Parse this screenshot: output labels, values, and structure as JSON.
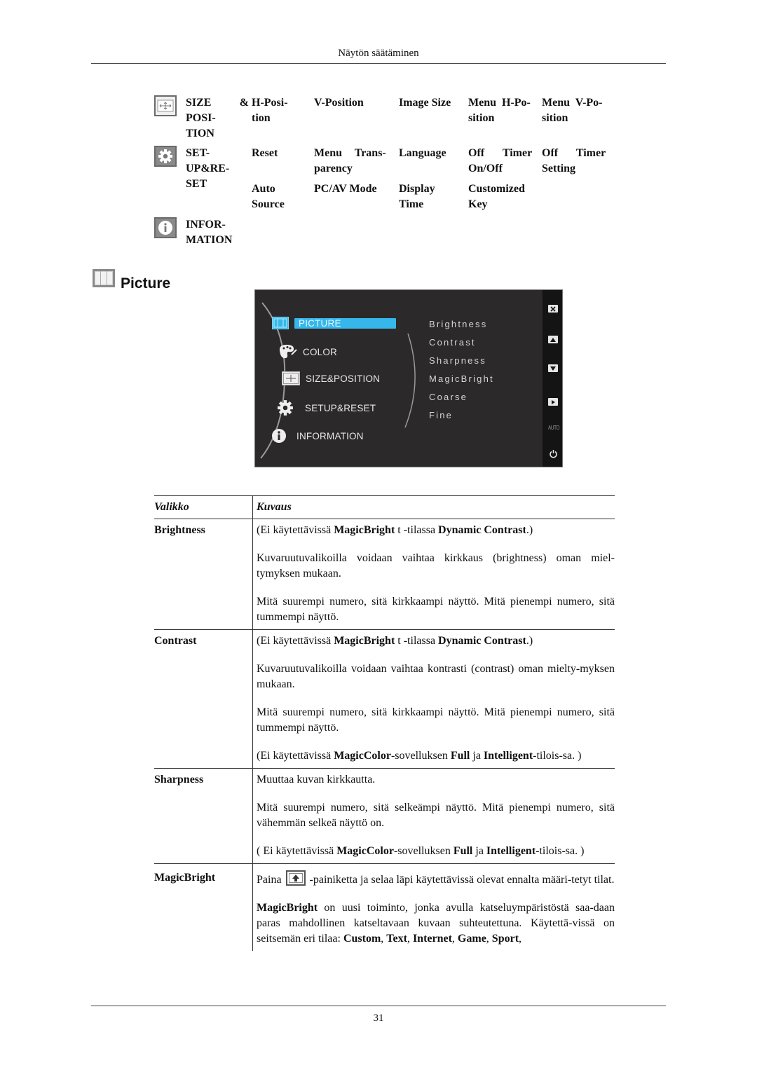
{
  "header": {
    "running_title": "Näytön säätäminen"
  },
  "overview": {
    "rows": [
      {
        "icon": "size-position-icon",
        "name": "SIZE & POSI- TION",
        "name_lines": [
          "SIZE",
          "POSI-",
          "TION"
        ],
        "name_amp": "&",
        "items": [
          {
            "lines": [
              "H-Posi-",
              "tion"
            ]
          },
          {
            "lines": [
              "V-Position"
            ]
          },
          {
            "lines": [
              "Image Size"
            ]
          },
          {
            "lines": [
              "Menu H-Po-",
              "sition"
            ]
          },
          {
            "lines": [
              "Menu V-Po-",
              "sition"
            ]
          }
        ]
      },
      {
        "icon": "gear-icon",
        "name_lines": [
          "SET-",
          "UP&RE-",
          "SET"
        ],
        "items": [
          {
            "lines": [
              "Reset"
            ]
          },
          {
            "lines": [
              "Menu Trans-",
              "parency"
            ]
          },
          {
            "lines": [
              "Language"
            ]
          },
          {
            "lines": [
              "Off Timer",
              "On/Off"
            ]
          },
          {
            "lines": [
              "Off Timer",
              "Setting"
            ]
          },
          {
            "lines": [
              "Auto",
              "Source"
            ]
          },
          {
            "lines": [
              "PC/AV Mode"
            ]
          },
          {
            "lines": [
              "Display",
              "Time"
            ]
          },
          {
            "lines": [
              "Customized",
              "Key"
            ]
          }
        ]
      },
      {
        "icon": "info-icon",
        "name_lines": [
          "INFOR-",
          "MATION"
        ],
        "items": []
      }
    ]
  },
  "section": {
    "title": "Picture",
    "icon": "picture-icon"
  },
  "osd": {
    "menu": [
      {
        "label": "PICTURE",
        "icon": "picture-icon",
        "active": true
      },
      {
        "label": "COLOR",
        "icon": "palette-icon",
        "active": false
      },
      {
        "label": "SIZE&POSITION",
        "icon": "size-position-icon",
        "active": false
      },
      {
        "label": "SETUP&RESET",
        "icon": "gear-icon",
        "active": false
      },
      {
        "label": "INFORMATION",
        "icon": "info-icon",
        "active": false
      }
    ],
    "submenu": [
      "Brightness",
      "Contrast",
      "Sharpness",
      "MagicBright",
      "Coarse",
      "Fine"
    ],
    "side_buttons": [
      "close-icon",
      "up-arrow-icon",
      "down-arrow-icon",
      "enter-icon",
      "auto",
      "power-icon"
    ],
    "side_auto_label": "AUTO",
    "accent_color": "#35b7ec"
  },
  "table": {
    "headers": {
      "menu": "Valikko",
      "description": "Kuvaus"
    },
    "rows": [
      {
        "menu": "Brightness",
        "paragraphs": [
          [
            [
              "(Ei käytettävissä ",
              false
            ],
            [
              "MagicBright",
              true
            ],
            [
              " t -tilassa ",
              false
            ],
            [
              "Dynamic Contrast",
              true
            ],
            [
              ".)",
              false
            ]
          ],
          [
            [
              "Kuvaruutuvalikoilla voidaan vaihtaa kirkkaus (brightness) oman miel-tymyksen mukaan.",
              false
            ]
          ],
          [
            [
              "Mitä suurempi numero, sitä kirkkaampi näyttö. Mitä pienempi numero, sitä tummempi näyttö.",
              false
            ]
          ]
        ]
      },
      {
        "menu": "Contrast",
        "paragraphs": [
          [
            [
              "(Ei käytettävissä ",
              false
            ],
            [
              "MagicBright",
              true
            ],
            [
              " t -tilassa ",
              false
            ],
            [
              "Dynamic Contrast",
              true
            ],
            [
              ".)",
              false
            ]
          ],
          [
            [
              "Kuvaruutuvalikoilla voidaan vaihtaa kontrasti (contrast) oman mielty-myksen mukaan.",
              false
            ]
          ],
          [
            [
              "Mitä suurempi numero, sitä kirkkaampi näyttö. Mitä pienempi numero, sitä tummempi näyttö.",
              false
            ]
          ],
          [
            [
              "(Ei käytettävissä ",
              false
            ],
            [
              "MagicColor",
              true
            ],
            [
              "-sovelluksen ",
              false
            ],
            [
              "Full",
              true
            ],
            [
              " ja ",
              false
            ],
            [
              "Intelligent",
              true
            ],
            [
              "-tilois-sa. )",
              false
            ]
          ]
        ]
      },
      {
        "menu": "Sharpness",
        "paragraphs": [
          [
            [
              "Muuttaa kuvan kirkkautta.",
              false
            ]
          ],
          [
            [
              "Mitä suurempi numero, sitä selkeämpi näyttö. Mitä pienempi numero, sitä vähemmän selkeä näyttö on.",
              false
            ]
          ],
          [
            [
              "( Ei käytettävissä ",
              false
            ],
            [
              "MagicColor",
              true
            ],
            [
              "-sovelluksen ",
              false
            ],
            [
              "Full",
              true
            ],
            [
              " ja ",
              false
            ],
            [
              "Intelligent",
              true
            ],
            [
              "-tilois-sa. )",
              false
            ]
          ]
        ]
      },
      {
        "menu": "MagicBright",
        "paragraphs": [
          [
            [
              "Paina ",
              false
            ],
            [
              "[[BUTTON]]",
              false
            ],
            [
              " -painiketta ja selaa läpi käytettävissä olevat ennalta määri-tetyt tilat.",
              false
            ]
          ],
          [
            [
              "MagicBright",
              true
            ],
            [
              " on uusi toiminto, jonka avulla katseluympäristöstä saa-daan paras mahdollinen katseltavaan kuvaan suhteutettuna. Käytettä-vissä on seitsemän eri tilaa: ",
              false
            ],
            [
              "Custom",
              true
            ],
            [
              ", ",
              false
            ],
            [
              "Text",
              true
            ],
            [
              ", ",
              false
            ],
            [
              "Internet",
              true
            ],
            [
              ", ",
              false
            ],
            [
              "Game",
              true
            ],
            [
              ", ",
              false
            ],
            [
              "Sport",
              true
            ],
            [
              ",",
              false
            ]
          ]
        ],
        "inline_button_icon": "magicbright-up-arrow-icon"
      }
    ]
  },
  "footer": {
    "page_number": "31"
  }
}
